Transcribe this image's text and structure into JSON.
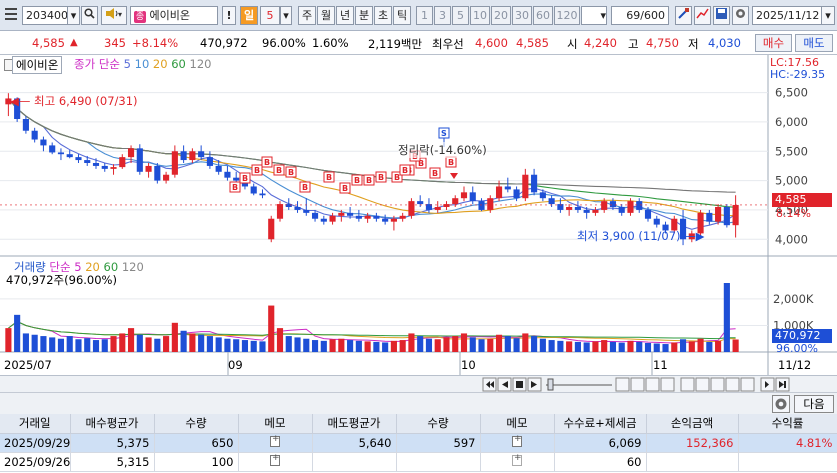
{
  "toolbar": {
    "code": "203400",
    "stock_name": "에이비온",
    "period_buttons": [
      "일",
      "5",
      "주",
      "월",
      "년",
      "분",
      "초",
      "틱"
    ],
    "min_buttons": [
      "1",
      "3",
      "5",
      "10",
      "20",
      "30",
      "60",
      "120"
    ],
    "count": "69/600",
    "date": "2025/11/12"
  },
  "quote": {
    "price": "4,585",
    "change": "345",
    "change_pct": "+8.14%",
    "volume": "470,972",
    "vol_ratio": "96.00%",
    "turnover": "1.60%",
    "amount": "2,119백만",
    "best_label": "최우선",
    "best_ask": "4,600",
    "best_bid": "4,585",
    "open_label": "시",
    "open": "4,240",
    "high_label": "고",
    "high": "4,750",
    "low_label": "저",
    "low": "4,030",
    "buy_label": "매수",
    "sell_label": "매도"
  },
  "chart_labels": {
    "price_name": "에이비온",
    "ma_label": "종가 단순",
    "ma_periods": [
      "5",
      "10",
      "20",
      "60",
      "120"
    ],
    "lc": "LC:17.56",
    "hc": "HC:-29.35",
    "high_note": "최고 6,490 (07/31)",
    "low_note": "최저 3,900 (11/07)",
    "signal_note": "정리락(-14.60%)",
    "current_price_tag": "4,585",
    "current_pct_tag": "8.14%",
    "vol_name": "거래량",
    "vol_ma_label": "단순",
    "vol_ma_periods": [
      "5",
      "20",
      "60",
      "120"
    ],
    "vol_value": "470,972주(96.00%)",
    "vol_tag": "470,972",
    "vol_pct_tag": "96.00%",
    "x_labels": [
      "2025/07",
      "09",
      "10",
      "11",
      "11/12"
    ]
  },
  "chart_data": {
    "type": "candlestick",
    "price_axis": [
      "6,500",
      "6,000",
      "5,500",
      "5,000",
      "4,500",
      "4,000"
    ],
    "price_range": [
      3800,
      6800
    ],
    "volume_axis": [
      "2,000K",
      "1,000K"
    ],
    "volume_range": [
      0,
      2600
    ],
    "candles": [
      [
        6300,
        6490,
        6100,
        6400
      ],
      [
        6400,
        6420,
        6000,
        6050
      ],
      [
        6050,
        6100,
        5800,
        5850
      ],
      [
        5850,
        5900,
        5650,
        5700
      ],
      [
        5700,
        5750,
        5500,
        5600
      ],
      [
        5600,
        5650,
        5450,
        5480
      ],
      [
        5480,
        5550,
        5350,
        5450
      ],
      [
        5450,
        5520,
        5380,
        5400
      ],
      [
        5400,
        5450,
        5300,
        5350
      ],
      [
        5350,
        5420,
        5250,
        5300
      ],
      [
        5300,
        5380,
        5200,
        5250
      ],
      [
        5250,
        5300,
        5150,
        5200
      ],
      [
        5200,
        5280,
        5100,
        5230
      ],
      [
        5230,
        5450,
        5200,
        5400
      ],
      [
        5400,
        5600,
        5300,
        5550
      ],
      [
        5550,
        5620,
        5100,
        5150
      ],
      [
        5150,
        5300,
        5050,
        5250
      ],
      [
        5250,
        5300,
        4950,
        5000
      ],
      [
        5000,
        5150,
        4950,
        5100
      ],
      [
        5100,
        5600,
        5050,
        5500
      ],
      [
        5500,
        5600,
        5300,
        5350
      ],
      [
        5350,
        5550,
        5300,
        5500
      ],
      [
        5500,
        5600,
        5350,
        5400
      ],
      [
        5400,
        5500,
        5200,
        5250
      ],
      [
        5250,
        5350,
        5100,
        5150
      ],
      [
        5150,
        5250,
        5000,
        5050
      ],
      [
        5050,
        5150,
        4950,
        5000
      ],
      [
        5000,
        5050,
        4850,
        4900
      ],
      [
        4900,
        4950,
        4750,
        4780
      ],
      [
        4780,
        4850,
        4700,
        4750
      ],
      [
        4000,
        4400,
        3950,
        4350
      ],
      [
        4350,
        4650,
        4300,
        4600
      ],
      [
        4600,
        4700,
        4500,
        4550
      ],
      [
        4550,
        4650,
        4450,
        4500
      ],
      [
        4500,
        4700,
        4400,
        4450
      ],
      [
        4450,
        4500,
        4300,
        4350
      ],
      [
        4350,
        4400,
        4250,
        4300
      ],
      [
        4300,
        4450,
        4250,
        4400
      ],
      [
        4400,
        4500,
        4300,
        4450
      ],
      [
        4450,
        4550,
        4350,
        4400
      ],
      [
        4400,
        4500,
        4300,
        4350
      ],
      [
        4350,
        4450,
        4280,
        4400
      ],
      [
        4400,
        4450,
        4300,
        4350
      ],
      [
        4350,
        4420,
        4250,
        4300
      ],
      [
        4300,
        4400,
        4150,
        4350
      ],
      [
        4350,
        4450,
        4300,
        4400
      ],
      [
        4400,
        4700,
        4350,
        4650
      ],
      [
        4650,
        4750,
        4550,
        4600
      ],
      [
        4600,
        4700,
        4450,
        4500
      ],
      [
        4500,
        4650,
        4450,
        4550
      ],
      [
        4550,
        4650,
        4500,
        4600
      ],
      [
        4600,
        4750,
        4550,
        4700
      ],
      [
        4700,
        4900,
        4650,
        4800
      ],
      [
        4800,
        4900,
        4600,
        4650
      ],
      [
        4650,
        4700,
        4480,
        4500
      ],
      [
        4500,
        4750,
        4450,
        4700
      ],
      [
        4700,
        5000,
        4650,
        4900
      ],
      [
        4900,
        5050,
        4800,
        4850
      ],
      [
        4850,
        4900,
        4650,
        4700
      ],
      [
        4700,
        5200,
        4650,
        5100
      ],
      [
        5100,
        5200,
        4750,
        4800
      ],
      [
        4800,
        4850,
        4650,
        4700
      ],
      [
        4700,
        4750,
        4550,
        4600
      ],
      [
        4600,
        4700,
        4450,
        4500
      ],
      [
        4500,
        4600,
        4400,
        4550
      ],
      [
        4550,
        4650,
        4450,
        4500
      ],
      [
        4500,
        4550,
        4350,
        4450
      ],
      [
        4450,
        4550,
        4400,
        4500
      ],
      [
        4500,
        4700,
        4450,
        4650
      ],
      [
        4650,
        4700,
        4500,
        4550
      ],
      [
        4550,
        4600,
        4400,
        4450
      ],
      [
        4450,
        4700,
        4400,
        4650
      ],
      [
        4650,
        4700,
        4450,
        4500
      ],
      [
        4500,
        4550,
        4300,
        4350
      ],
      [
        4350,
        4400,
        4200,
        4250
      ],
      [
        4250,
        4300,
        4100,
        4150
      ],
      [
        4150,
        4400,
        4100,
        4350
      ],
      [
        4350,
        4500,
        3900,
        4000
      ],
      [
        4000,
        4150,
        3950,
        4100
      ],
      [
        4100,
        4500,
        4050,
        4450
      ],
      [
        4450,
        4500,
        4250,
        4300
      ],
      [
        4300,
        4600,
        4250,
        4550
      ],
      [
        4550,
        4600,
        4200,
        4240
      ],
      [
        4240,
        4750,
        4030,
        4585
      ]
    ],
    "volumes": [
      900,
      1400,
      700,
      650,
      600,
      550,
      500,
      600,
      480,
      520,
      450,
      480,
      600,
      700,
      900,
      650,
      550,
      500,
      600,
      1100,
      800,
      700,
      650,
      600,
      550,
      500,
      480,
      450,
      420,
      400,
      1750,
      900,
      600,
      550,
      500,
      450,
      420,
      480,
      500,
      450,
      420,
      400,
      380,
      360,
      420,
      450,
      700,
      600,
      500,
      480,
      550,
      600,
      700,
      550,
      480,
      500,
      650,
      600,
      520,
      700,
      600,
      500,
      450,
      420,
      400,
      380,
      360,
      400,
      450,
      380,
      350,
      420,
      380,
      340,
      320,
      300,
      360,
      480,
      400,
      500,
      380,
      420,
      2600,
      471
    ]
  },
  "nav": {
    "zoom_labels": [
      "◀",
      "▶"
    ]
  },
  "panel": {
    "next_label": "다음"
  },
  "table": {
    "headers": [
      "거래일",
      "매수평균가",
      "수량",
      "메모",
      "매도평균가",
      "수량",
      "메모",
      "수수료+제세금",
      "손익금액",
      "수익률"
    ],
    "rows": [
      {
        "date": "2025/09/29",
        "buy_avg": "5,375",
        "buy_qty": "650",
        "sell_avg": "5,640",
        "sell_qty": "597",
        "fee": "6,069",
        "pnl": "152,366",
        "rate": "4.81%"
      },
      {
        "date": "2025/09/26",
        "buy_avg": "5,315",
        "buy_qty": "100",
        "sell_avg": "",
        "sell_qty": "",
        "fee": "60",
        "pnl": "",
        "rate": ""
      }
    ]
  }
}
